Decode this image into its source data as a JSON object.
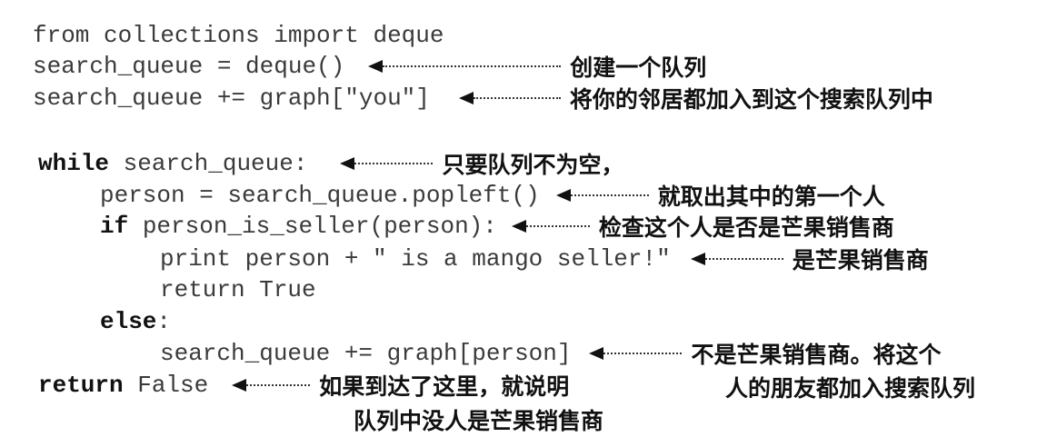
{
  "code": {
    "l1": "from collections import deque",
    "l2": "search_queue = deque()",
    "l3": "search_queue += graph[\"you\"]",
    "l4_kw": "while",
    "l4": " search_queue:",
    "l5": "person = search_queue.popleft()",
    "l6_kw": "if",
    "l6": " person_is_seller(person):",
    "l7": "print person + \" is a mango seller!\"",
    "l8": "return True",
    "l9_kw": "else",
    "l9": ":",
    "l10": "search_queue += graph[person]",
    "l11_kw": "return",
    "l11": " False"
  },
  "annotations": {
    "a2": "创建一个队列",
    "a3": "将你的邻居都加入到这个搜索队列中",
    "a4": "只要队列不为空，",
    "a5": "就取出其中的第一个人",
    "a6": "检查这个人是否是芒果销售商",
    "a7": "是芒果销售商",
    "a10_line1": "不是芒果销售商。将这个",
    "a10_line2": "人的朋友都加入搜索队列",
    "a11_line1": "如果到达了这里，就说明",
    "a11_line2": "队列中没人是芒果销售商"
  }
}
